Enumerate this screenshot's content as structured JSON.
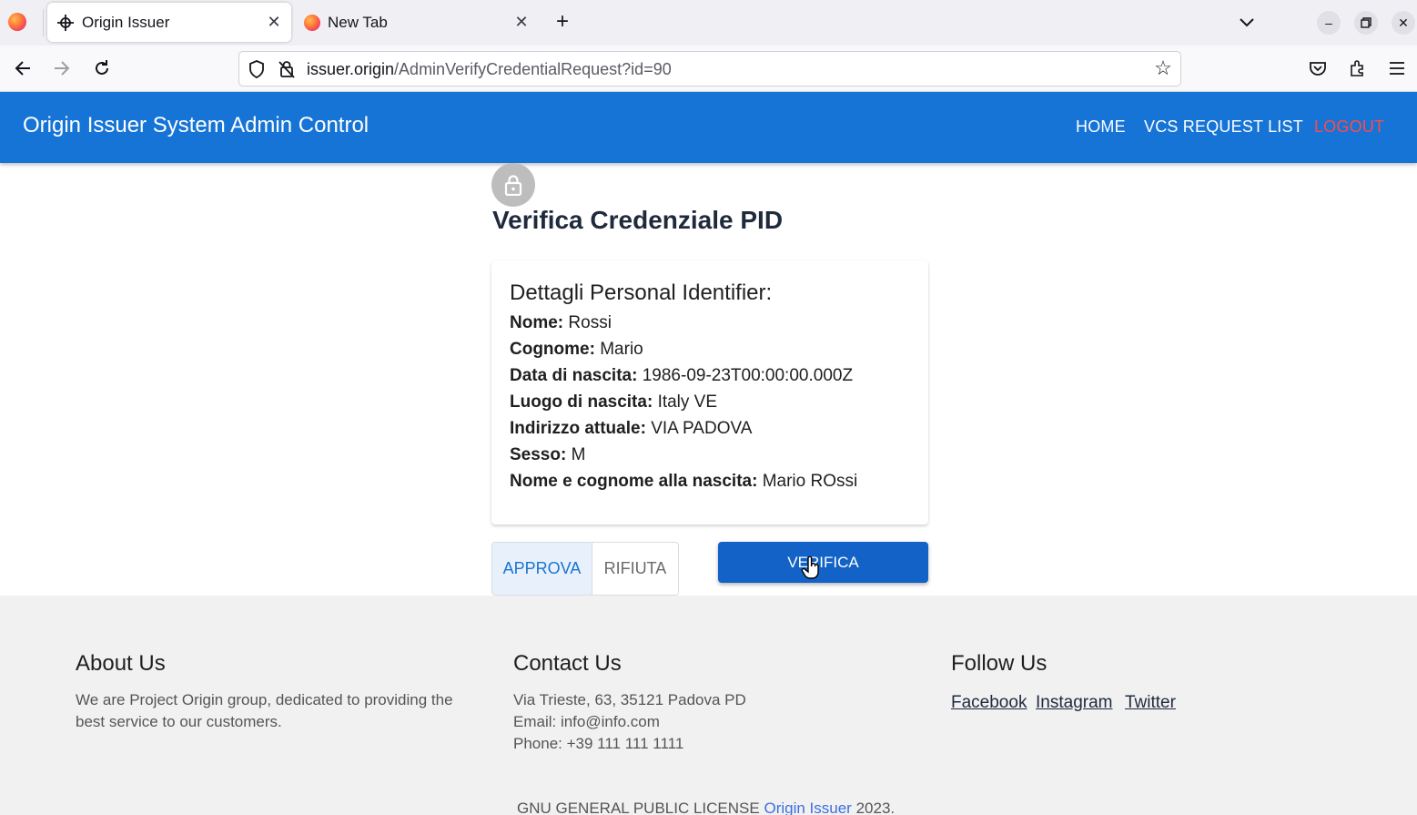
{
  "browser": {
    "tabs": [
      {
        "title": "Origin Issuer",
        "icon": "crosshair-icon",
        "active": true
      },
      {
        "title": "New Tab",
        "icon": "firefox-icon",
        "active": false
      }
    ],
    "url": {
      "host": "issuer.origin",
      "path": "/AdminVerifyCredentialRequest?id=90"
    }
  },
  "header": {
    "title": "Origin Issuer System Admin Control",
    "menu": {
      "home": "HOME",
      "vcs_request_list": "VCS REQUEST LIST",
      "logout": "LOGOUT"
    }
  },
  "main": {
    "title": "Verifica Credenziale PID",
    "card": {
      "title": "Dettagli Personal Identifier:",
      "fields": [
        {
          "label": "Nome:",
          "value": "Rossi"
        },
        {
          "label": "Cognome:",
          "value": "Mario"
        },
        {
          "label": "Data di nascita:",
          "value": "1986-09-23T00:00:00.000Z"
        },
        {
          "label": "Luogo di nascita:",
          "value": "Italy VE"
        },
        {
          "label": "Indirizzo attuale:",
          "value": "VIA PADOVA"
        },
        {
          "label": "Sesso:",
          "value": "M"
        },
        {
          "label": "Nome e cognome alla nascita:",
          "value": "Mario ROssi"
        }
      ]
    },
    "actions": {
      "approve": "APPROVA",
      "reject": "RIFIUTA",
      "verify": "VERIFICA"
    }
  },
  "footer": {
    "about": {
      "heading": "About Us",
      "text_line1": "We are Project Origin group, dedicated to providing the",
      "text_line2": "best service to our customers."
    },
    "contact": {
      "heading": "Contact Us",
      "address": "Via Trieste, 63, 35121 Padova PD",
      "email": "Email: info@info.com",
      "phone": "Phone: +39 111 111 1111"
    },
    "follow": {
      "heading": "Follow Us",
      "links": [
        "Facebook",
        "Instagram",
        "Twitter"
      ]
    },
    "license": {
      "prefix": "GNU GENERAL PUBLIC LICENSE",
      "brand": "Origin Issuer",
      "year": "2023."
    }
  },
  "colors": {
    "header_bg": "#1574d6",
    "logout": "#ff4a4a",
    "verify_bg": "#1262c7",
    "approve_text": "#1a74d2"
  }
}
